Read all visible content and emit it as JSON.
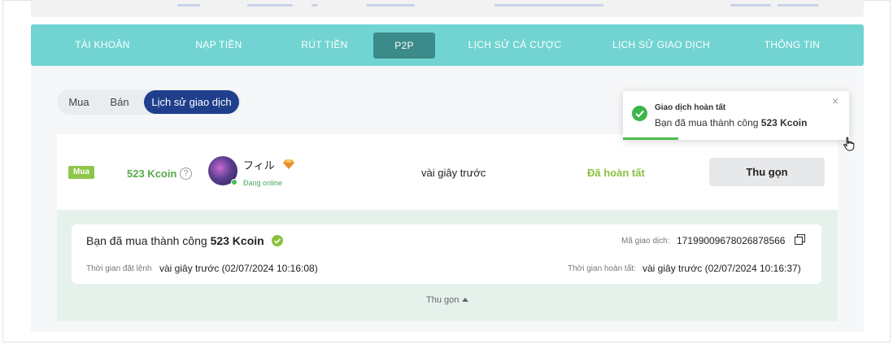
{
  "nav": {
    "items": [
      {
        "label": "TÀI KHOẢN"
      },
      {
        "label": "NẠP TIỀN"
      },
      {
        "label": "RÚT TIỀN"
      },
      {
        "label": "P2P"
      },
      {
        "label": "LỊCH SỬ CÁ CƯỢC"
      },
      {
        "label": "LỊCH SỬ GIAO DỊCH"
      },
      {
        "label": "THÔNG TIN"
      }
    ],
    "active": "P2P",
    "colors": {
      "bar": "#71d4d2",
      "active": "#3a8b89"
    }
  },
  "segment": {
    "buy": "Mua",
    "sell": "Bán",
    "history": "Lịch sử giao dịch",
    "active": "Lịch sử giao dịch"
  },
  "transaction": {
    "type_tag": "Mua",
    "amount": "523 Kcoin",
    "help_icon": "?",
    "user": {
      "name": "フィル",
      "badge_icon": "diamond-icon",
      "status": "Đang online"
    },
    "time": "vài giây trước",
    "status": "Đã hoàn tất",
    "collapse_label": "Thu gọn"
  },
  "detail": {
    "title_prefix": "Bạn đã mua thành công",
    "title_amount": "523 Kcoin",
    "tx_id_label": "Mã giao dịch:",
    "tx_id": "17199009678026878566",
    "order_time_label": "Thời gian đặt lệnh",
    "order_time": "vài giây trước (02/07/2024 10:16:08)",
    "complete_time_label": "Thời gian hoàn tất:",
    "complete_time": "vài giây trước (02/07/2024 10:16:37)",
    "collapse_link": "Thu gọn"
  },
  "toast": {
    "title": "Giao dịch hoàn tất",
    "message_prefix": "Bạn đã mua thành công",
    "message_amount": "523 Kcoin",
    "close": "×",
    "colors": {
      "success": "#3cb54a"
    }
  }
}
